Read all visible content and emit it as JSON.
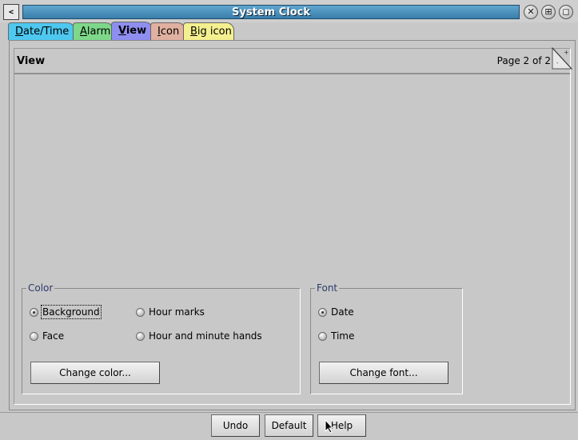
{
  "window": {
    "title": "System Clock",
    "sysmenu_glyph": "<",
    "close_glyph": "✕",
    "iconify_glyph": "⊞",
    "maximize_glyph": "◻"
  },
  "tabs": [
    {
      "pre": "",
      "mn": "D",
      "post": "ate/Time",
      "color": "#4ec8f0"
    },
    {
      "pre": "",
      "mn": "A",
      "post": "larm",
      "color": "#7ed88a"
    },
    {
      "pre": "",
      "mn": "V",
      "post": "iew",
      "color": "#8e8ef0"
    },
    {
      "pre": "",
      "mn": "I",
      "post": "con",
      "color": "#e0b0a0"
    },
    {
      "pre": "",
      "mn": "B",
      "post": "ig icon",
      "color": "#f4f090"
    }
  ],
  "page": {
    "title": "View",
    "page_info": "Page 2 of 2"
  },
  "color_group": {
    "legend": "Color",
    "options": [
      "Background",
      "Face",
      "Hour marks",
      "Hour and minute hands"
    ],
    "selected": "Background",
    "button": "Change color..."
  },
  "font_group": {
    "legend": "Font",
    "options": [
      "Date",
      "Time"
    ],
    "selected": "Date",
    "button": "Change font..."
  },
  "footer": {
    "undo": "Undo",
    "default": "Default",
    "help": "Help"
  },
  "colors": {
    "titlebar": "#3a7eab",
    "background": "#c8c8c8",
    "legend_text": "#2d3a6a"
  }
}
